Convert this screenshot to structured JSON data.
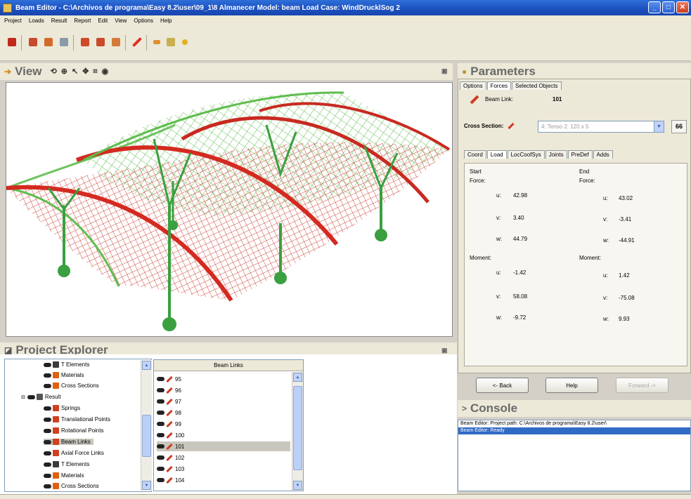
{
  "window": {
    "title": "Beam Editor - C:\\Archivos de programa\\Easy 8.2\\user\\09_1\\8 Almanecer  Model: beam  Load Case: WindDrucklSog 2",
    "minimize": "_",
    "maximize": "□",
    "close": "✕"
  },
  "menubar": [
    "Project",
    "Loads",
    "Result",
    "Report",
    "Edit",
    "View",
    "Options",
    "Help"
  ],
  "view_panel": {
    "title": "View",
    "icons": [
      "rotate-icon",
      "zoom-icon",
      "select-pointer-icon",
      "pan-icon",
      "fit-icon",
      "camera-icon"
    ]
  },
  "parameters": {
    "title": "Parameters",
    "tabs": [
      "Options",
      "Forces",
      "Selected Objects"
    ],
    "active_tab": "Forces",
    "beam_link_label": "Beam Link:",
    "beam_link_value": "101",
    "cross_section_label": "Cross Section:",
    "cross_section_value": "4: Tenso 2: 120 x 5",
    "glasses_button": "66",
    "subtabs": [
      "Coord",
      "Load",
      "LocCoofSys",
      "Joints",
      "PreDef",
      "Adds"
    ],
    "active_subtab": "Load",
    "start_label": "Start",
    "end_label": "End",
    "force_label": "Force:",
    "moment_label": "Moment:",
    "start_force": [
      {
        "axis": "u:",
        "value": "42.98"
      },
      {
        "axis": "v:",
        "value": "3.40"
      },
      {
        "axis": "w:",
        "value": "44.79"
      }
    ],
    "end_force": [
      {
        "axis": "u:",
        "value": "43.02"
      },
      {
        "axis": "v:",
        "value": "-3.41"
      },
      {
        "axis": "w:",
        "value": "-44.91"
      }
    ],
    "start_moment": [
      {
        "axis": "u:",
        "value": "-1.42"
      },
      {
        "axis": "v:",
        "value": "58.08"
      },
      {
        "axis": "w:",
        "value": "-9.72"
      }
    ],
    "end_moment": [
      {
        "axis": "u:",
        "value": "1.42"
      },
      {
        "axis": "v:",
        "value": "-75.08"
      },
      {
        "axis": "w:",
        "value": "9.93"
      }
    ],
    "back_button": "<- Back",
    "help_button": "Help",
    "forward_button": "Forward ->"
  },
  "console": {
    "title": "Console",
    "lines": [
      "Beam Editor: Project path: C:\\Archivos de programa\\Easy 8.2\\user\\",
      "Beam Editor: Ready"
    ]
  },
  "project_explorer": {
    "title": "Project Explorer",
    "tree": [
      {
        "label": "T Elements",
        "depth": 3,
        "icon": "t-elements-icon",
        "color": "#3b3b3b"
      },
      {
        "label": "Materials",
        "depth": 3,
        "icon": "materials-icon",
        "color": "#e06010"
      },
      {
        "label": "Cross Sections",
        "depth": 3,
        "icon": "cross-sections-icon",
        "color": "#e06010"
      },
      {
        "label": "Result",
        "depth": 2,
        "icon": "result-folder-icon",
        "color": "#555555"
      },
      {
        "label": "Springs",
        "depth": 3,
        "icon": "springs-icon",
        "color": "#d04020"
      },
      {
        "label": "Translational Points",
        "depth": 3,
        "icon": "translational-points-icon",
        "color": "#d04020"
      },
      {
        "label": "Rotational Points",
        "depth": 3,
        "icon": "rotational-points-icon",
        "color": "#d04020"
      },
      {
        "label": "Beam Links",
        "depth": 3,
        "icon": "beam-links-icon",
        "color": "#d04020"
      },
      {
        "label": "Axial Force Links",
        "depth": 3,
        "icon": "axial-force-links-icon",
        "color": "#d04020"
      },
      {
        "label": "T Elements",
        "depth": 3,
        "icon": "t-elements-icon",
        "color": "#3b3b3b"
      },
      {
        "label": "Materials",
        "depth": 3,
        "icon": "materials-icon",
        "color": "#e06010"
      },
      {
        "label": "Cross Sections",
        "depth": 3,
        "icon": "cross-sections-icon",
        "color": "#e06010"
      }
    ],
    "list_header": "Beam Links",
    "list_items": [
      "95",
      "96",
      "97",
      "98",
      "99",
      "100",
      "101",
      "102",
      "103",
      "104"
    ],
    "selected_item": "101"
  }
}
